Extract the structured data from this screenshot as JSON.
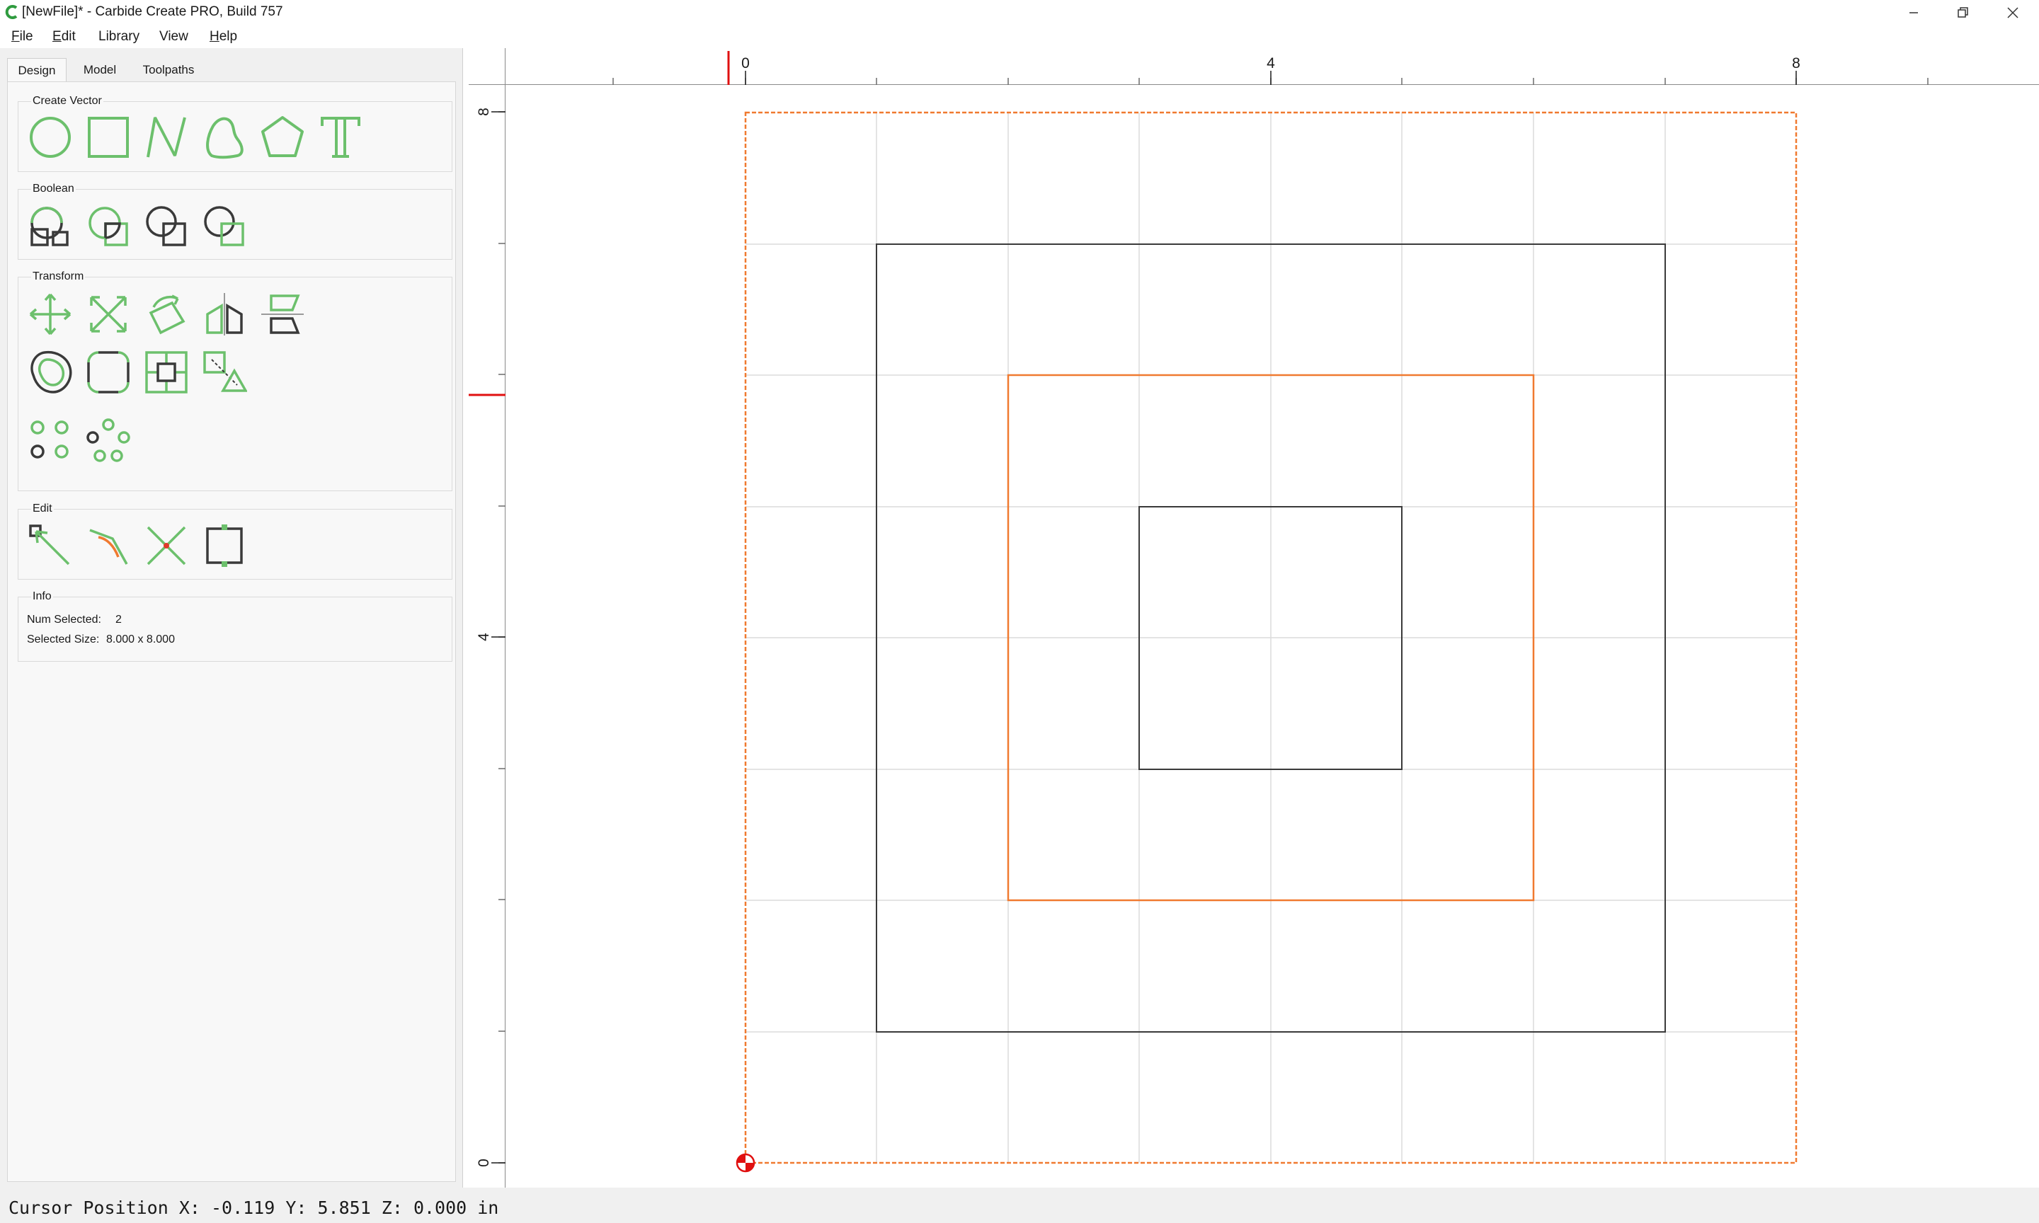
{
  "window": {
    "title": "[NewFile]* - Carbide Create PRO, Build 757",
    "buttons": [
      "minimize",
      "restore",
      "close"
    ]
  },
  "menubar": {
    "items": [
      {
        "label": "File",
        "mnemonic": "F"
      },
      {
        "label": "Edit",
        "mnemonic": "E"
      },
      {
        "label": "Library"
      },
      {
        "label": "View"
      },
      {
        "label": "Help",
        "mnemonic": "H"
      }
    ]
  },
  "tabs": [
    {
      "label": "Design",
      "active": true
    },
    {
      "label": "Model",
      "active": false
    },
    {
      "label": "Toolpaths",
      "active": false
    }
  ],
  "panel": {
    "create_vector": {
      "title": "Create Vector",
      "tools": [
        "circle-icon",
        "rectangle-icon",
        "polyline-icon",
        "curve-icon",
        "polygon-icon",
        "text-icon"
      ]
    },
    "boolean": {
      "title": "Boolean",
      "tools": [
        "boolean-union-icon",
        "boolean-subtract-icon",
        "boolean-intersect-icon",
        "boolean-weld-icon"
      ]
    },
    "transform": {
      "title": "Transform",
      "tools": [
        "move-icon",
        "scale-icon",
        "rotate-icon",
        "mirror-icon",
        "align-icon",
        "offset-icon",
        "fillet-icon",
        "center-icon",
        "array-icon",
        "circular-pattern-grid-icon",
        "circular-pattern-icon"
      ]
    },
    "edit": {
      "title": "Edit",
      "tools": [
        "node-edit-icon",
        "curve-edit-icon",
        "trim-icon",
        "bounding-box-icon"
      ]
    },
    "info": {
      "title": "Info",
      "num_selected_label": "Num Selected:",
      "num_selected_value": "2",
      "selected_size_label": "Selected Size:",
      "selected_size_value": "8.000 x 8.000"
    }
  },
  "rulers": {
    "top_labels": [
      "0",
      "4",
      "8"
    ],
    "left_labels": [
      "8",
      "4",
      "0"
    ]
  },
  "status": {
    "cursor_position": "Cursor Position X: -0.119 Y: 5.851 Z: 0.000 in"
  },
  "colors": {
    "tool_green": "#6cc06c",
    "tool_dark": "#3a3a3a",
    "selection_orange": "#f07a30",
    "grid": "#dcdcdc",
    "origin_red": "#e01010"
  }
}
